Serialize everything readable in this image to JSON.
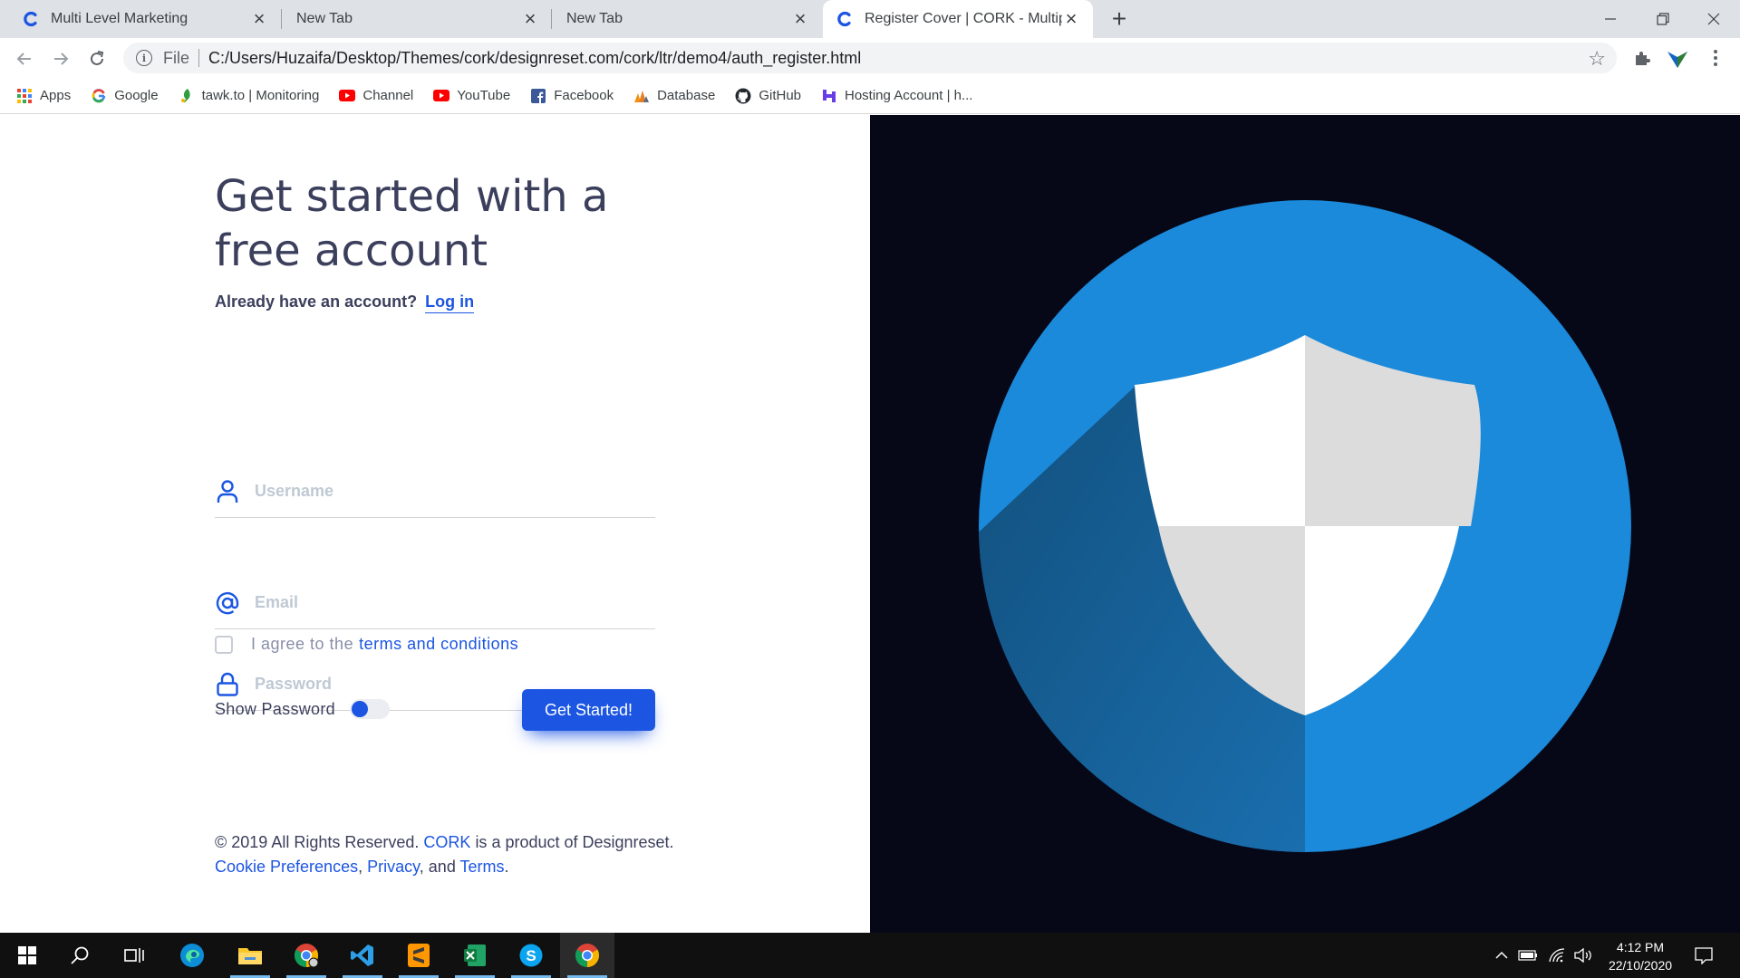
{
  "browser": {
    "tabs": [
      {
        "title": "Multi Level Marketing",
        "active": false
      },
      {
        "title": "New Tab",
        "active": false
      },
      {
        "title": "New Tab",
        "active": false
      },
      {
        "title": "Register Cover | CORK - Multipurp",
        "active": true
      }
    ],
    "address": {
      "scheme_label": "File",
      "url": "C:/Users/Huzaifa/Desktop/Themes/cork/designreset.com/cork/ltr/demo4/auth_register.html"
    },
    "bookmarks": [
      {
        "label": "Apps",
        "icon": "apps-grid-icon"
      },
      {
        "label": "Google",
        "icon": "google-icon"
      },
      {
        "label": "tawk.to | Monitoring",
        "icon": "tawk-icon"
      },
      {
        "label": "Channel",
        "icon": "youtube-icon"
      },
      {
        "label": "YouTube",
        "icon": "youtube-icon"
      },
      {
        "label": "Facebook",
        "icon": "facebook-icon"
      },
      {
        "label": "Database",
        "icon": "database-icon"
      },
      {
        "label": "GitHub",
        "icon": "github-icon"
      },
      {
        "label": "Hosting Account | h...",
        "icon": "hosting-icon"
      }
    ]
  },
  "page": {
    "heading": "Get started with a free account",
    "already_text": "Already have an account?",
    "login_link": "Log in",
    "fields": {
      "username_placeholder": "Username",
      "email_placeholder": "Email",
      "password_placeholder": "Password"
    },
    "agree_text": "I agree to the",
    "terms_link": "terms and conditions",
    "show_password_label": "Show Password",
    "submit_label": "Get Started!",
    "footer": {
      "copyright": "© 2019 All Rights Reserved.",
      "brand_link": "CORK",
      "product_text": "is a product of Designreset.",
      "cookie_link": "Cookie Preferences",
      "privacy_link": "Privacy",
      "and_text": ", and",
      "terms_link": "Terms"
    }
  },
  "taskbar": {
    "time": "4:12 PM",
    "date": "22/10/2020"
  },
  "colors": {
    "accent": "#1b55e2",
    "text": "#3b3f5c",
    "hero_bg": "#060818",
    "circle": "#1b8adb"
  }
}
